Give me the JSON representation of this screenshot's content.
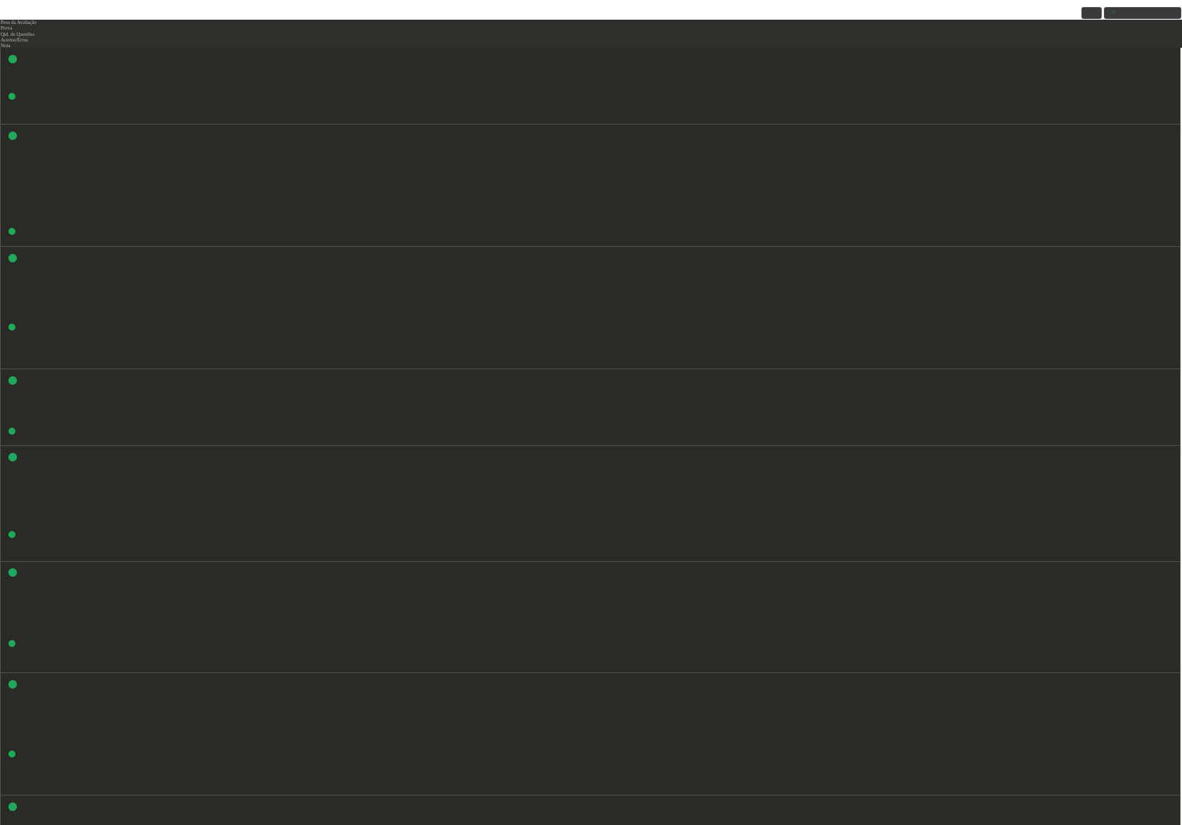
{
  "header": {
    "labels": [
      "Peso da Avaliação",
      "Prova",
      "Qtd. de Questões",
      "Acertos/Erros",
      "Nota"
    ]
  },
  "toolbar": {
    "menu_icon": "≡"
  },
  "theme": {
    "accent": "#1fa95a",
    "panel_bg": "#2a2a26",
    "header_bg": "#2f2f2b"
  },
  "rows_count": 9
}
